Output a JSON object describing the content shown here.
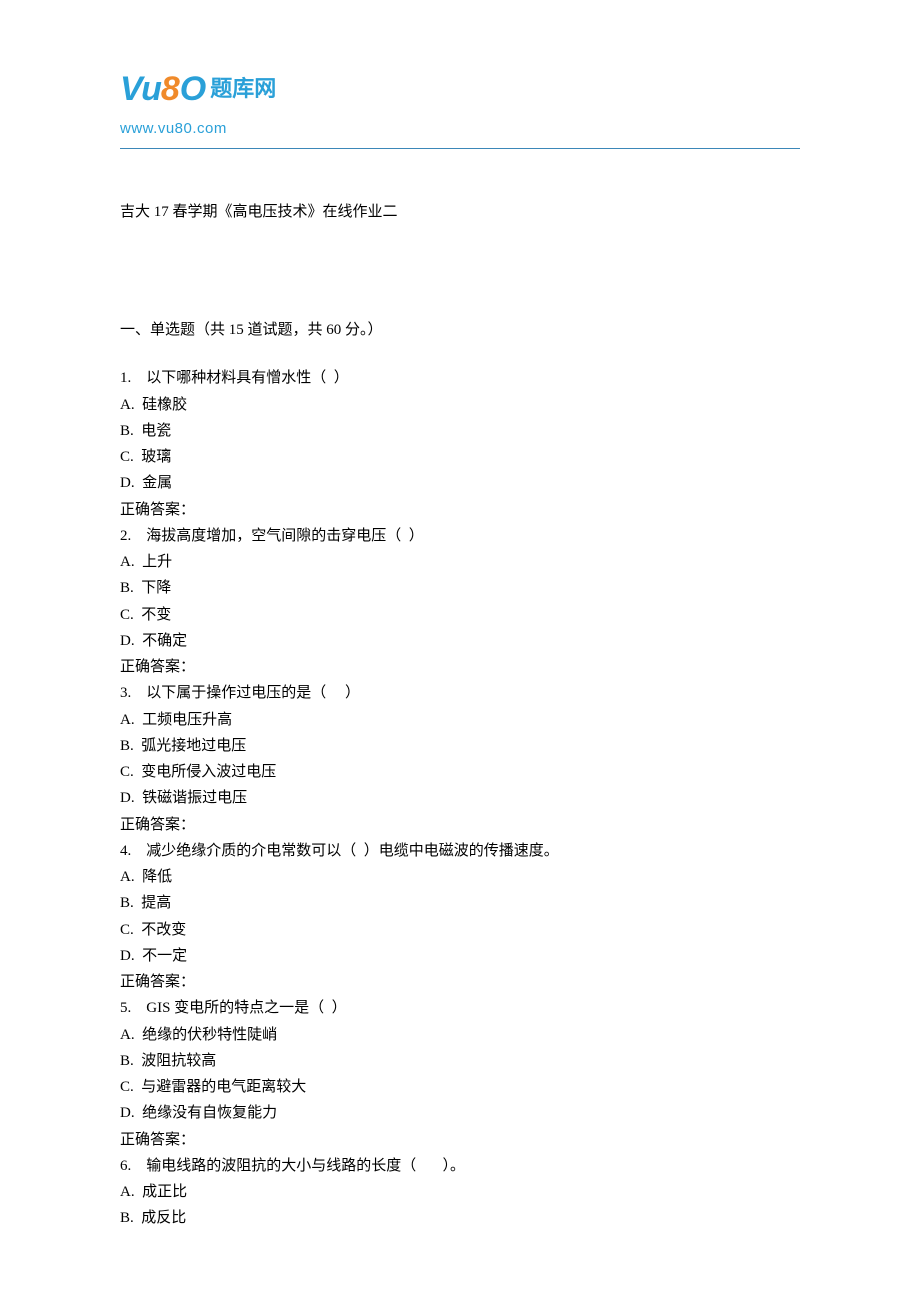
{
  "logo": {
    "vu": "Vu",
    "eight": "8",
    "o": "O",
    "cn": "题库网",
    "url": "www.vu80.com"
  },
  "title": "吉大 17 春学期《高电压技术》在线作业二",
  "section_header": "一、单选题（共  15  道试题，共  60  分。）",
  "questions": [
    {
      "stem": "1.    以下哪种材料具有憎水性（  ）",
      "options": [
        "A.  硅橡胶",
        "B.  电瓷",
        "C.  玻璃",
        "D.  金属"
      ],
      "answer_label": "正确答案："
    },
    {
      "stem": "2.    海拔高度增加，空气间隙的击穿电压（  ）",
      "options": [
        "A.  上升",
        "B.  下降",
        "C.  不变",
        "D.  不确定"
      ],
      "answer_label": "正确答案："
    },
    {
      "stem": "3.    以下属于操作过电压的是（     ）",
      "options": [
        "A.  工频电压升高",
        "B.  弧光接地过电压",
        "C.  变电所侵入波过电压",
        "D.  铁磁谐振过电压"
      ],
      "answer_label": "正确答案："
    },
    {
      "stem": "4.    减少绝缘介质的介电常数可以（  ）电缆中电磁波的传播速度。",
      "options": [
        "A.  降低",
        "B.  提高",
        "C.  不改变",
        "D.  不一定"
      ],
      "answer_label": "正确答案："
    },
    {
      "stem": "5.    GIS 变电所的特点之一是（  ）",
      "options": [
        "A.  绝缘的伏秒特性陡峭",
        "B.  波阻抗较高",
        "C.  与避雷器的电气距离较大",
        "D.  绝缘没有自恢复能力"
      ],
      "answer_label": "正确答案："
    },
    {
      "stem": "6.    输电线路的波阻抗的大小与线路的长度（       ）。",
      "options": [
        "A.  成正比",
        "B.  成反比"
      ],
      "answer_label": ""
    }
  ]
}
